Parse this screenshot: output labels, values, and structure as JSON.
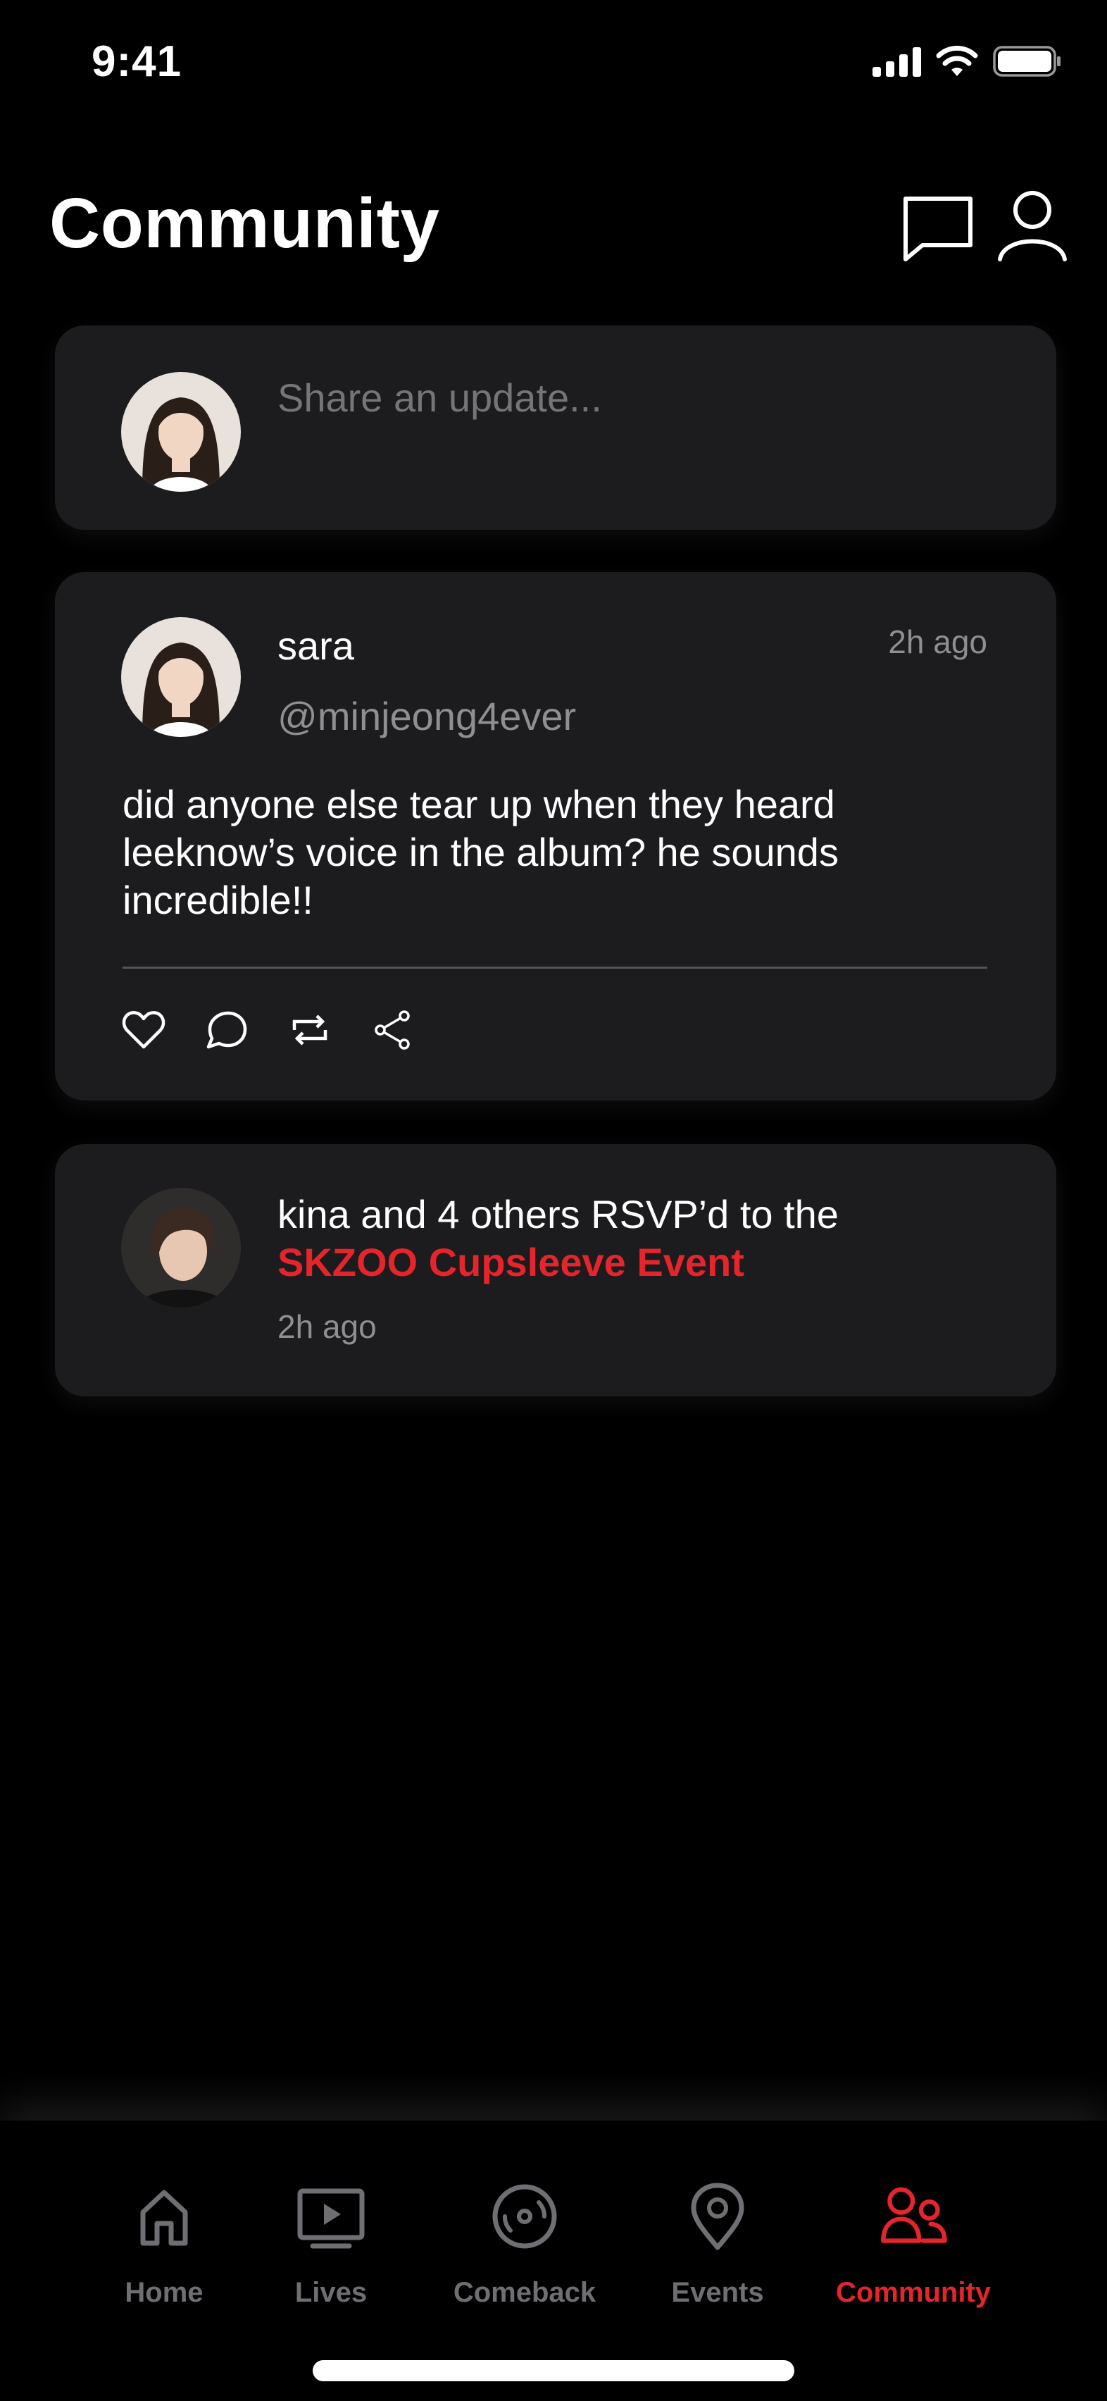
{
  "status_bar": {
    "time": "9:41"
  },
  "header": {
    "title": "Community",
    "icons": [
      "chat-icon",
      "profile-icon"
    ]
  },
  "composer": {
    "placeholder": "Share an update..."
  },
  "post": {
    "name": "sara",
    "handle": "@minjeong4ever",
    "time": "2h ago",
    "body": "did anyone else tear up when they heard leeknow’s voice in the album? he sounds incredible!!",
    "actions": [
      "heart-icon",
      "comment-icon",
      "repost-icon",
      "share-icon"
    ]
  },
  "activity": {
    "text": "kina and 4 others RSVP’d to the",
    "event": "SKZOO Cupsleeve Event",
    "time": "2h ago"
  },
  "tabbar": {
    "active": "Community",
    "tabs": [
      {
        "label": "Home",
        "icon": "home-icon"
      },
      {
        "label": "Lives",
        "icon": "play-icon"
      },
      {
        "label": "Comeback",
        "icon": "disc-icon"
      },
      {
        "label": "Events",
        "icon": "location-pin-icon"
      },
      {
        "label": "Community",
        "icon": "community-icon"
      }
    ]
  },
  "colors": {
    "background": "#000000",
    "card": "#1c1c1e",
    "accent": "#e5242c",
    "muted": "#8e8e93",
    "inactive_tab": "#6f6f73"
  }
}
